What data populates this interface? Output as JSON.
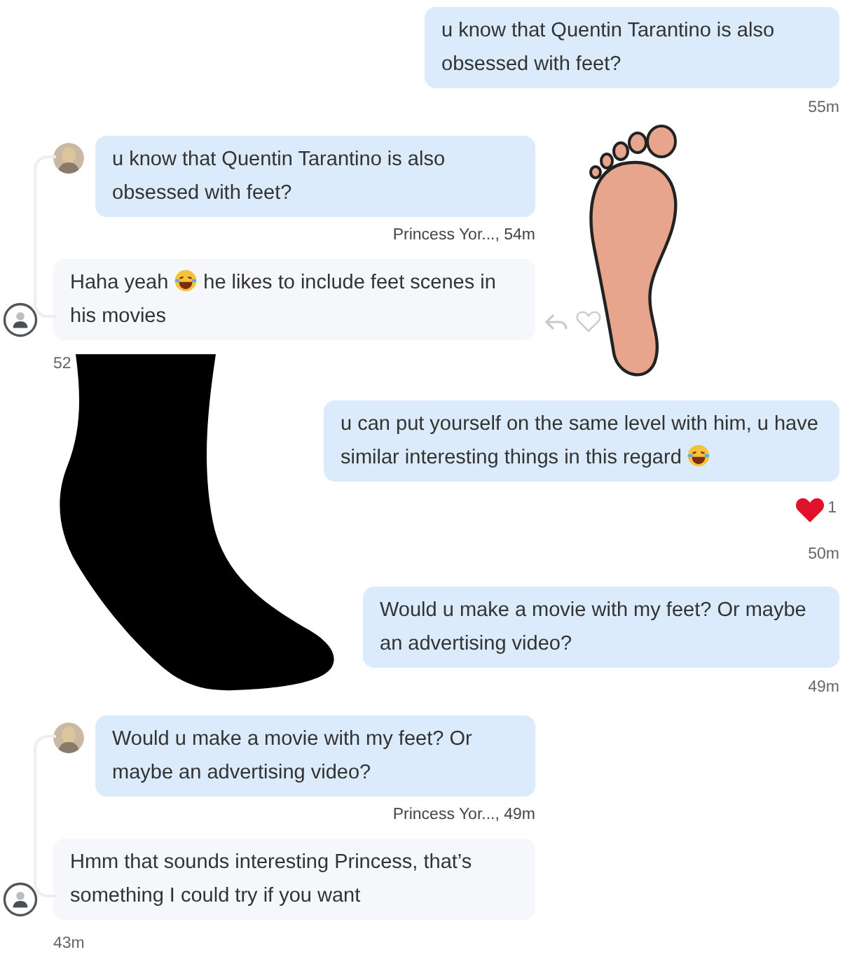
{
  "messages": [
    {
      "kind": "sent",
      "text": "u know that Quentin Tarantino is also obsessed with feet?",
      "time": "55m"
    },
    {
      "kind": "reply",
      "quote": {
        "text": "u know that Quentin Tarantino is also obsessed with feet?",
        "meta": "Princess Yor..., 54m"
      },
      "segments": [
        {
          "kind": "text",
          "text": "Haha yeah"
        },
        {
          "kind": "emoji"
        },
        {
          "kind": "text",
          "text": "he likes to include feet scenes in his movies"
        }
      ],
      "actions": true,
      "time": "52"
    },
    {
      "kind": "sent",
      "segments": [
        {
          "kind": "text",
          "text": "u can put yourself on the same level with him, u have similar interesting things in this regard"
        },
        {
          "kind": "emoji"
        }
      ],
      "reaction": {
        "count": "1"
      },
      "time": "50m"
    },
    {
      "kind": "sent",
      "text": "Would u make a movie with my feet? Or maybe an advertising video?",
      "time": "49m"
    },
    {
      "kind": "reply",
      "quote": {
        "text": "Would u make a movie with my feet? Or maybe an advertising video?",
        "meta": "Princess Yor..., 49m"
      },
      "segments": [
        {
          "kind": "text",
          "text": "Hmm that sounds interesting Princess, that’s something I could try if you want"
        }
      ],
      "actions": false,
      "time": "43m"
    }
  ]
}
